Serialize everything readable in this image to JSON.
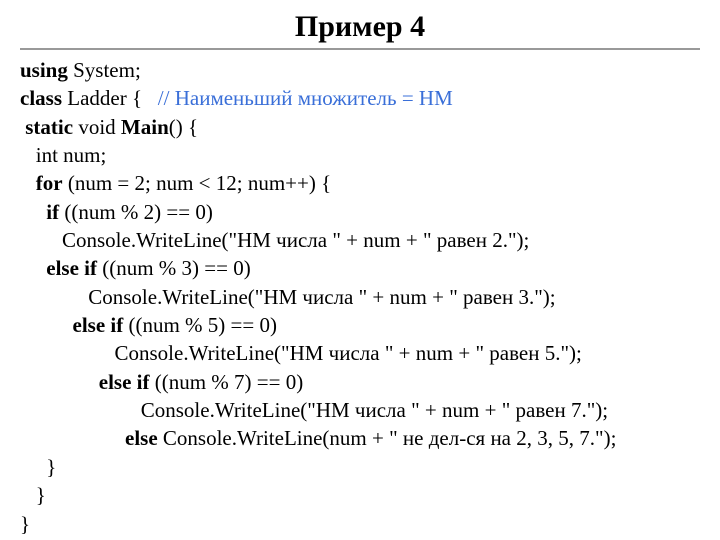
{
  "title": "Пример 4",
  "code": {
    "l1_kw": "using",
    "l1_rest": " System;",
    "l2_kw": "class",
    "l2_rest": " Ladder {   ",
    "l2_comment": "// Наименьший множитель = НМ",
    "l3_pre": " ",
    "l3_kw1": "static",
    "l3_mid": " void ",
    "l3_kw2": "Main",
    "l3_rest": "() {",
    "l4": "   int num;",
    "l5_pre": "   ",
    "l5_kw": "for",
    "l5_rest": " (num = 2; num < 12; num++) {",
    "l6_pre": "     ",
    "l6_kw": "if",
    "l6_rest": " ((num % 2) == 0)",
    "l7": "        Console.WriteLine(\"HM числа \" + num + \" равен 2.\");",
    "l8_pre": "     ",
    "l8_kw": "else if",
    "l8_rest": " ((num % 3) == 0)",
    "l9": "             Console.WriteLine(\"HM числа \" + num + \" равен 3.\");",
    "l10_pre": "          ",
    "l10_kw": "else if",
    "l10_rest": " ((num % 5) == 0)",
    "l11": "                  Console.WriteLine(\"HM числа \" + num + \" равен 5.\");",
    "l12_pre": "               ",
    "l12_kw": "else if",
    "l12_rest": " ((num % 7) == 0)",
    "l13": "                       Console.WriteLine(\"HM числа \" + num + \" равен 7.\");",
    "l14_pre": "                    ",
    "l14_kw": "else",
    "l14_rest": " Console.WriteLine(num + \" не дел-ся на 2, 3, 5, 7.\");",
    "l15": "     }",
    "l16": "   }",
    "l17": "}"
  }
}
